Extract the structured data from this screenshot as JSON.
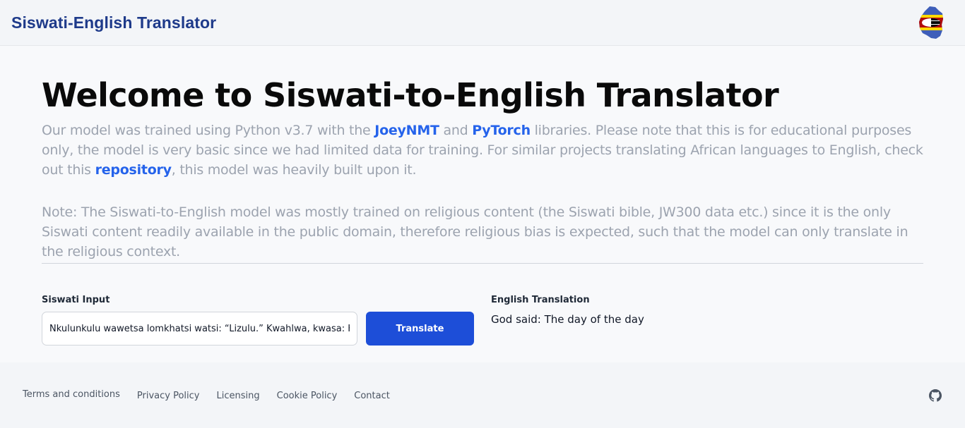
{
  "header": {
    "brand": "Siswati-English Translator",
    "logo_icon": "eswatini-flag-map-icon"
  },
  "hero": {
    "title": "Welcome to Siswati-to-English Translator",
    "intro": {
      "part1": "Our model was trained using Python v3.7 with the ",
      "link1": "JoeyNMT",
      "part2": " and ",
      "link2": "PyTorch",
      "part3": " libraries. Please note that this is for educational purposes only, the model is very basic since we had limited data for training. For similar projects translating African languages to English, check out this ",
      "link3": "repository",
      "part4": ", this model was heavily built upon it."
    },
    "note": "Note: The Siswati-to-English model was mostly trained on religious content (the Siswati bible, JW300 data etc.) since it is the only Siswati content readily available in the public domain, therefore religious bias is expected, such that the model can only translate in the religious context."
  },
  "translator": {
    "input_label": "Siswati Input",
    "input_value": "Nkulunkulu wawetsa lomkhatsi watsi: “Lizulu.” Kwahlwa, kwasa: Kwaba lilanga lesibili.",
    "button_label": "Translate",
    "output_label": "English Translation",
    "output_value": "God said: The day of the day"
  },
  "footer": {
    "links": [
      "Terms and conditions",
      "Privacy Policy",
      "Licensing",
      "Cookie Policy",
      "Contact"
    ],
    "github_icon": "github-icon"
  },
  "colors": {
    "brand": "#1e3a8a",
    "link": "#2563eb",
    "button": "#1d4ed8",
    "muted_text": "#9ca3af"
  }
}
